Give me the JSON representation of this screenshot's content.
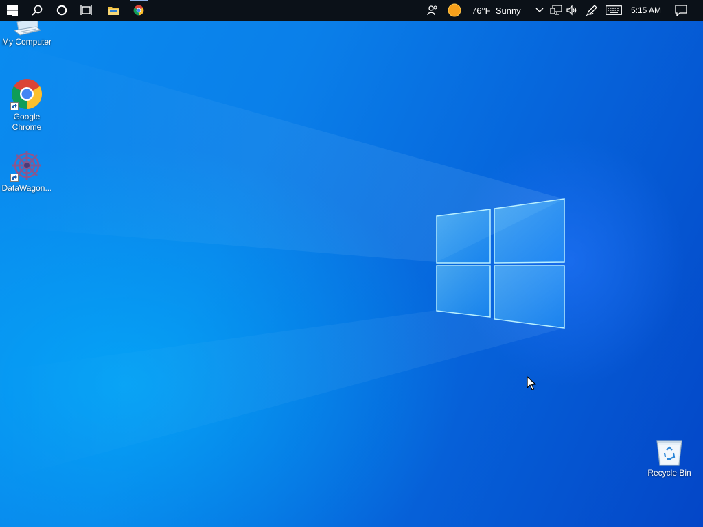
{
  "taskbar": {
    "buttons": [
      {
        "name": "start",
        "icon": "windows-logo-icon"
      },
      {
        "name": "search",
        "icon": "search-icon"
      },
      {
        "name": "cortana",
        "icon": "cortana-circle-icon"
      },
      {
        "name": "task-view",
        "icon": "task-view-icon"
      },
      {
        "name": "file-explorer",
        "icon": "folder-icon"
      },
      {
        "name": "chrome",
        "icon": "chrome-icon",
        "active": true
      }
    ],
    "tray": {
      "people_icon": "people-icon",
      "weather_icon": "sun-icon",
      "weather_text": "76°F  Sunny",
      "show_hidden_icon": "chevron-up-icon",
      "network_icon": "network-icon",
      "volume_icon": "volume-icon",
      "pen_icon": "pen-icon",
      "keyboard_icon": "keyboard-icon",
      "clock": "5:15 AM",
      "notifications_icon": "action-center-icon"
    }
  },
  "desktop": {
    "icons": [
      {
        "id": "my-computer",
        "label": "My Computer",
        "icon": "computer-icon"
      },
      {
        "id": "google-chrome",
        "label": "Google Chrome",
        "icon": "chrome-icon",
        "shortcut": true
      },
      {
        "id": "datawagon",
        "label": "DataWagon...",
        "icon": "datawagon-icon",
        "shortcut": true
      },
      {
        "id": "recycle-bin",
        "label": "Recycle Bin",
        "icon": "recycle-bin-icon"
      }
    ]
  },
  "colors": {
    "taskbar_bg": "#0b1118",
    "wallpaper_light": "#0a8cf0",
    "wallpaper_dark": "#0446c7",
    "weather_sun": "#f7a01b"
  }
}
